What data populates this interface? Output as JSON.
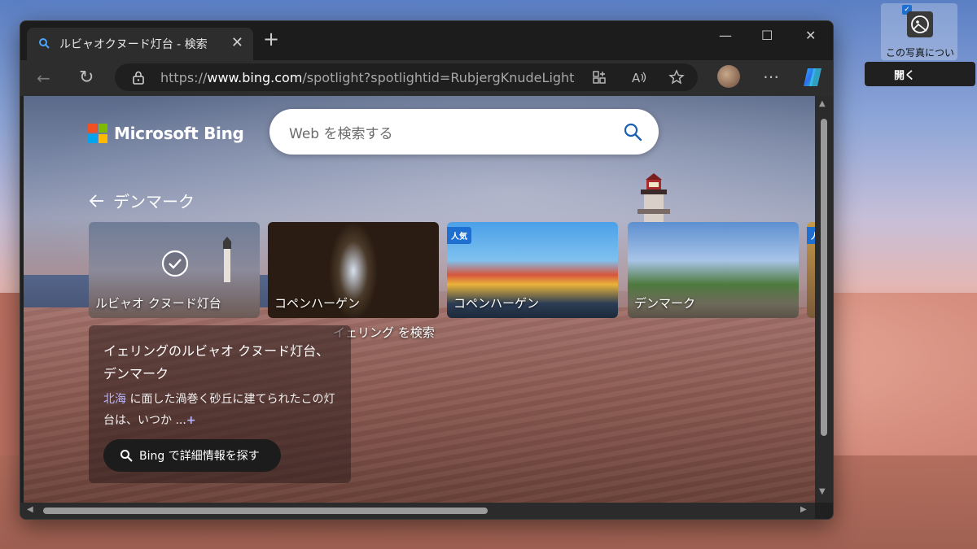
{
  "tab": {
    "title": "ルビャオクヌード灯台 - 検索",
    "close": "✕"
  },
  "newtab": "+",
  "window_controls": {
    "minimize": "—",
    "maximize": "☐",
    "close": "✕"
  },
  "toolbar": {
    "back": "←",
    "refresh": "↻",
    "url_prefix": "https://",
    "url_host": "www.bing.com",
    "url_path": "/spotlight?spotlightid=RubjergKnudeLighthous...",
    "more": "⋯"
  },
  "bing": {
    "brand": "Microsoft Bing",
    "search_placeholder": "Web を検索する",
    "back_label": "デンマーク",
    "cards": [
      {
        "label": "ルビャオ クヌード灯台",
        "badge": ""
      },
      {
        "label": "コペンハーゲン",
        "badge": ""
      },
      {
        "label": "コペンハーゲン",
        "badge": "人気"
      },
      {
        "label": "デンマーク",
        "badge": ""
      },
      {
        "label": "",
        "badge": "人"
      }
    ],
    "search_hint": "イェリング を検索",
    "info": {
      "title": "イェリングのルビャオ クヌード灯台、デンマーク",
      "desc_link": "北海",
      "desc_rest": " に面した渦巻く砂丘に建てられたこの灯台は、いつか ...",
      "desc_plus": "+",
      "button": "Bing で詳細情報を探す"
    }
  },
  "widget": {
    "text": "この写真につい",
    "open": "開く",
    "check": "✓"
  },
  "colors": {
    "ms_red": "#f25022",
    "ms_green": "#7fba00",
    "ms_blue": "#00a4ef",
    "ms_yellow": "#ffb900",
    "accent": "#1f6fd1"
  }
}
